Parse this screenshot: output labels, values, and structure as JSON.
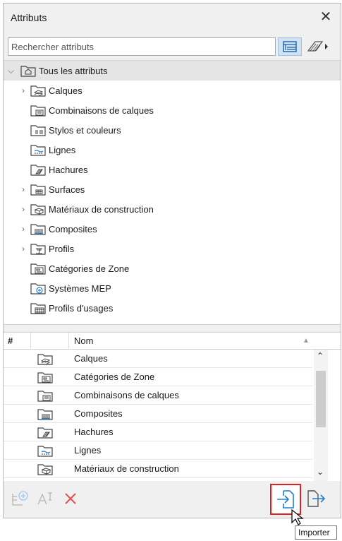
{
  "window": {
    "title": "Attributs"
  },
  "search": {
    "placeholder": "Rechercher attributs"
  },
  "tree": {
    "root_label": "Tous les attributs",
    "items": [
      {
        "label": "Calques",
        "expandable": true,
        "icon": "layers-icon"
      },
      {
        "label": "Combinaisons de calques",
        "expandable": false,
        "icon": "layer-combinations-icon"
      },
      {
        "label": "Stylos et couleurs",
        "expandable": false,
        "icon": "pens-colors-icon"
      },
      {
        "label": "Lignes",
        "expandable": false,
        "icon": "line-types-icon"
      },
      {
        "label": "Hachures",
        "expandable": false,
        "icon": "fill-types-icon"
      },
      {
        "label": "Surfaces",
        "expandable": true,
        "icon": "surfaces-icon"
      },
      {
        "label": "Matériaux de construction",
        "expandable": true,
        "icon": "building-materials-icon"
      },
      {
        "label": "Composites",
        "expandable": true,
        "icon": "composites-icon"
      },
      {
        "label": "Profils",
        "expandable": true,
        "icon": "profiles-icon"
      },
      {
        "label": "Catégories de Zone",
        "expandable": false,
        "icon": "zone-categories-icon"
      },
      {
        "label": "Systèmes MEP",
        "expandable": false,
        "icon": "mep-systems-icon"
      },
      {
        "label": "Profils d'usages",
        "expandable": false,
        "icon": "operation-profiles-icon"
      }
    ]
  },
  "list": {
    "col_index": "#",
    "col_name": "Nom",
    "rows": [
      {
        "label": "Calques",
        "icon": "layers-icon"
      },
      {
        "label": "Catégories de Zone",
        "icon": "zone-categories-icon"
      },
      {
        "label": "Combinaisons de calques",
        "icon": "layer-combinations-icon"
      },
      {
        "label": "Composites",
        "icon": "composites-icon"
      },
      {
        "label": "Hachures",
        "icon": "fill-types-icon"
      },
      {
        "label": "Lignes",
        "icon": "line-types-icon"
      },
      {
        "label": "Matériaux de construction",
        "icon": "building-materials-icon"
      }
    ]
  },
  "tooltip": {
    "text": "Importer"
  },
  "colors": {
    "accent_blue": "#1c7fd6",
    "delete_red": "#e8504a",
    "highlight_red": "#e02020"
  }
}
